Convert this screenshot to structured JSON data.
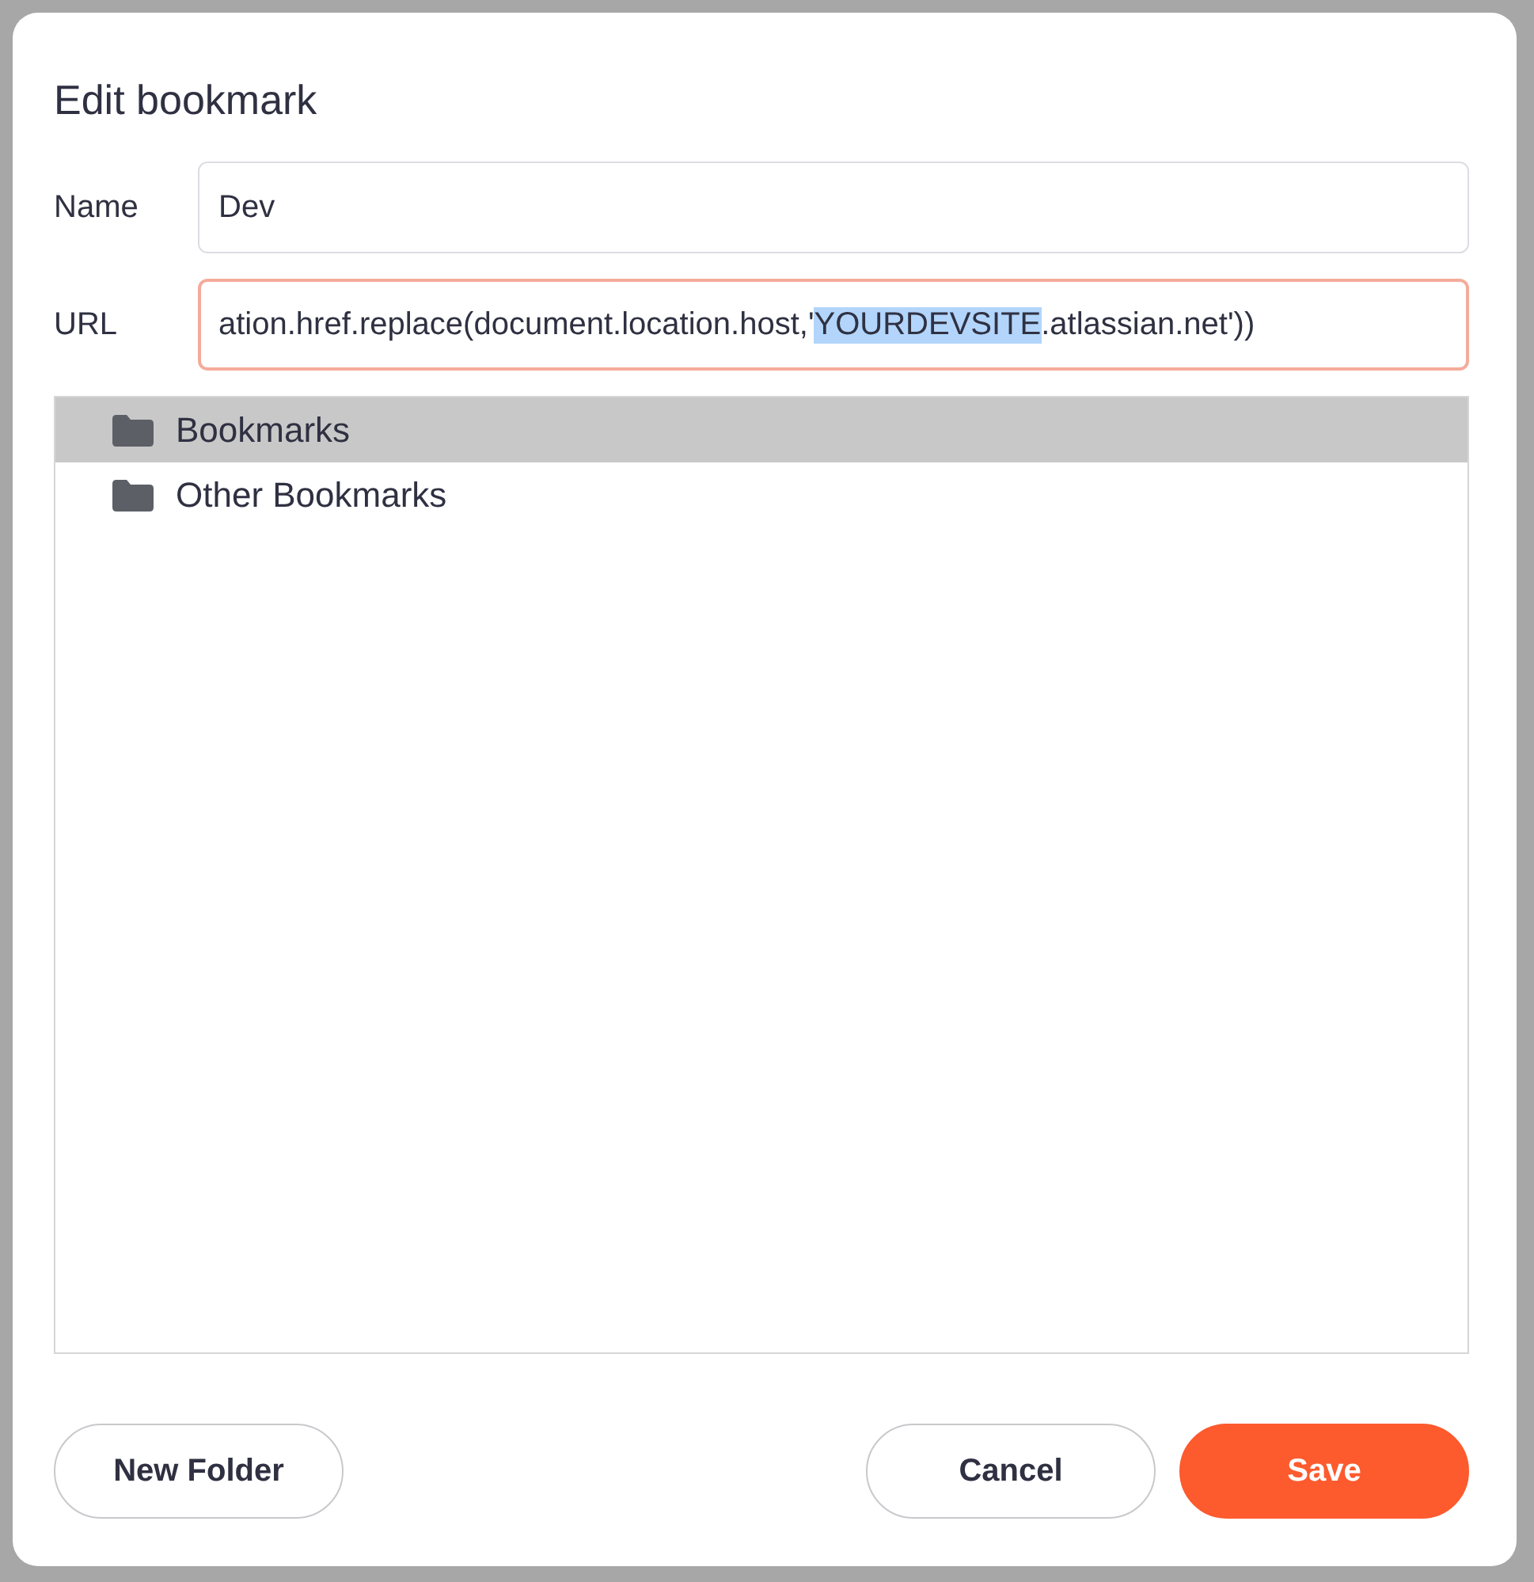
{
  "dialog": {
    "title": "Edit bookmark"
  },
  "fields": [
    {
      "label": "Name",
      "value_parts": [
        {
          "text": "Dev",
          "selected": false
        }
      ],
      "focused": false
    },
    {
      "label": "URL",
      "value_parts": [
        {
          "text": "ation.href.replace(document.location.host,'",
          "selected": false
        },
        {
          "text": "YOURDEVSITE",
          "selected": true
        },
        {
          "text": ".atlassian.net'))",
          "selected": false
        }
      ],
      "focused": true
    }
  ],
  "folders": [
    {
      "label": "Bookmarks",
      "selected": true
    },
    {
      "label": "Other Bookmarks",
      "selected": false
    }
  ],
  "buttons": [
    {
      "label": "New Folder",
      "kind": "secondary"
    },
    {
      "label": "Cancel",
      "kind": "secondary"
    },
    {
      "label": "Save",
      "kind": "primary"
    }
  ]
}
